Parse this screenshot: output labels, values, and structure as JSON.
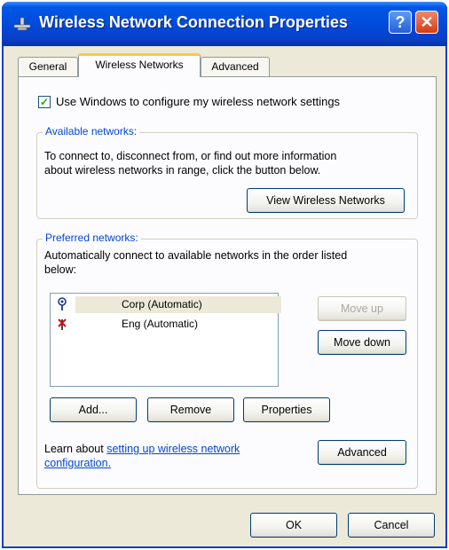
{
  "window": {
    "title": "Wireless Network Connection Properties",
    "help_label": "?",
    "close_label": "✕"
  },
  "tabs": [
    {
      "label": "General"
    },
    {
      "label": "Wireless Networks"
    },
    {
      "label": "Advanced"
    }
  ],
  "use_windows": {
    "label": "Use Windows to configure my wireless network settings",
    "checked": true
  },
  "available": {
    "legend": "Available networks:",
    "description_line1": "To connect to, disconnect from, or find out more information",
    "description_line2": "about wireless networks in range, click the button below.",
    "view_button": "View Wireless Networks"
  },
  "preferred": {
    "legend": "Preferred networks:",
    "description_line1": "Automatically connect to available networks in the order listed",
    "description_line2": "below:",
    "networks": [
      {
        "label": "Corp (Automatic)",
        "icon": "wireless-antenna-icon",
        "selected": true
      },
      {
        "label": "Eng (Automatic)",
        "icon": "wireless-antenna-disconnected-icon",
        "selected": false
      }
    ],
    "move_up": "Move up",
    "move_down": "Move down",
    "add": "Add...",
    "remove": "Remove",
    "properties": "Properties"
  },
  "learn": {
    "prefix": "Learn about ",
    "link_line1": "setting up wireless network",
    "link_line2": "configuration.",
    "advanced_button": "Advanced"
  },
  "footer": {
    "ok": "OK",
    "cancel": "Cancel"
  }
}
